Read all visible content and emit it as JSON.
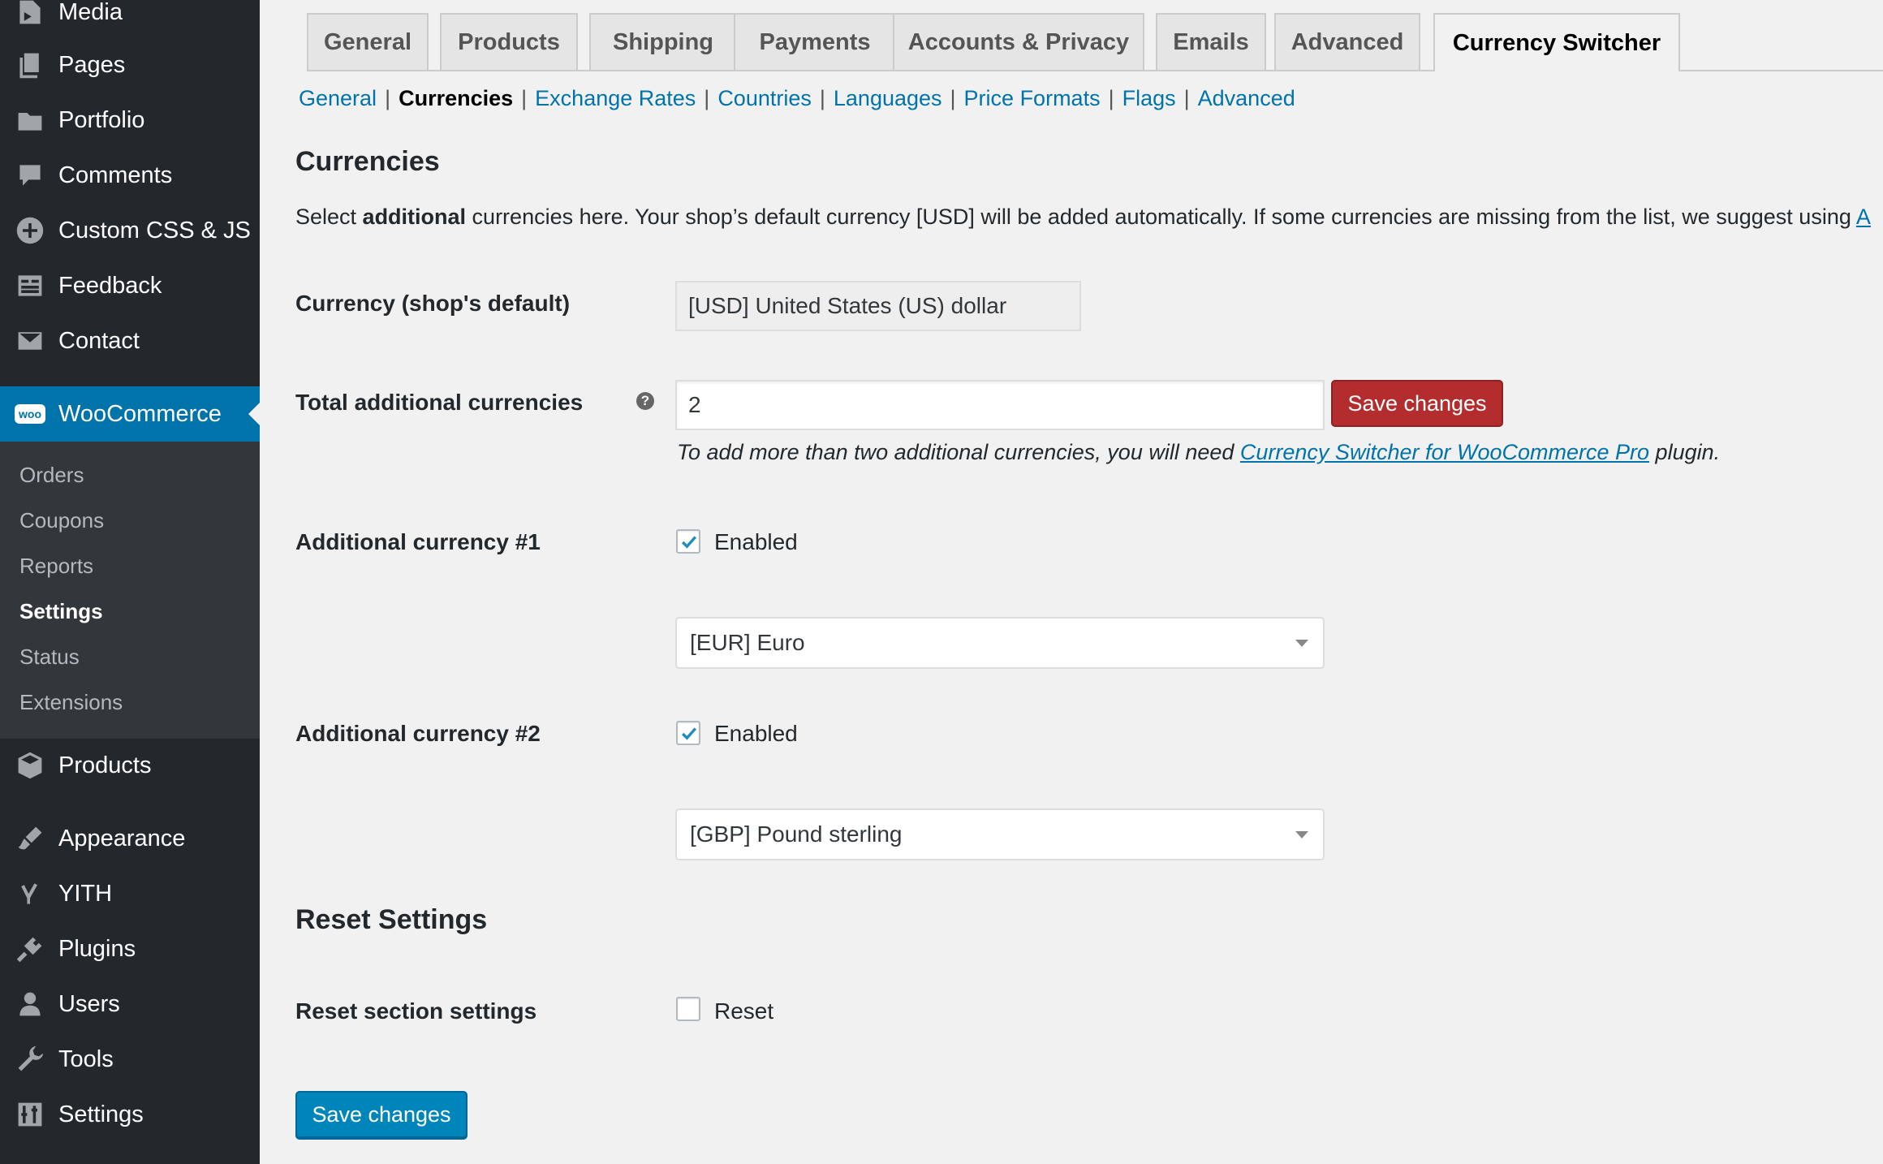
{
  "sidebar": {
    "items": [
      {
        "label": "Media",
        "icon": "media-icon"
      },
      {
        "label": "Pages",
        "icon": "pages-icon"
      },
      {
        "label": "Portfolio",
        "icon": "portfolio-icon"
      },
      {
        "label": "Comments",
        "icon": "comments-icon"
      },
      {
        "label": "Custom CSS & JS",
        "icon": "plus-circle-icon"
      },
      {
        "label": "Feedback",
        "icon": "feedback-icon"
      },
      {
        "label": "Contact",
        "icon": "mail-icon"
      }
    ],
    "woocommerce": {
      "label": "WooCommerce",
      "icon": "woocommerce-icon",
      "icon_text": "woo"
    },
    "woo_submenu": [
      "Orders",
      "Coupons",
      "Reports",
      "Settings",
      "Status",
      "Extensions"
    ],
    "woo_submenu_current": "Settings",
    "lower_items": [
      {
        "label": "Products",
        "icon": "products-box-icon"
      },
      {
        "label": "Appearance",
        "icon": "appearance-brush-icon"
      },
      {
        "label": "YITH",
        "icon": "yith-icon"
      },
      {
        "label": "Plugins",
        "icon": "plugins-icon"
      },
      {
        "label": "Users",
        "icon": "users-icon"
      },
      {
        "label": "Tools",
        "icon": "tools-wrench-icon"
      },
      {
        "label": "Settings",
        "icon": "settings-sliders-icon"
      }
    ]
  },
  "tabs": [
    "General",
    "Products",
    "Shipping",
    "Payments",
    "Accounts & Privacy",
    "Emails",
    "Advanced",
    "Currency Switcher"
  ],
  "active_tab": "Currency Switcher",
  "subnav": [
    "General",
    "Currencies",
    "Exchange Rates",
    "Countries",
    "Languages",
    "Price Formats",
    "Flags",
    "Advanced"
  ],
  "subnav_current": "Currencies",
  "section": {
    "title": "Currencies",
    "intro_prefix": "Select ",
    "intro_bold": "additional",
    "intro_rest": " currencies here. Your shop’s default currency [USD] will be added automatically. If some currencies are missing from the list, we suggest using ",
    "intro_link_fragment": "A"
  },
  "default_currency": {
    "label": "Currency (shop's default)",
    "value": "[USD] United States (US) dollar"
  },
  "total_additional": {
    "label": "Total additional currencies",
    "help": "?",
    "value": "2",
    "save_label": "Save changes",
    "desc_prefix": "To add more than two additional currencies, you will need ",
    "desc_link": "Currency Switcher for WooCommerce Pro",
    "desc_suffix": " plugin."
  },
  "additional": [
    {
      "label": "Additional currency #1",
      "enabled": true,
      "enabled_label": "Enabled",
      "value": "[EUR] Euro"
    },
    {
      "label": "Additional currency #2",
      "enabled": true,
      "enabled_label": "Enabled",
      "value": "[GBP] Pound sterling"
    }
  ],
  "reset": {
    "title": "Reset Settings",
    "row_label": "Reset section settings",
    "checkbox_label": "Reset",
    "checked": false
  },
  "footer": {
    "save_label": "Save changes"
  },
  "colors": {
    "sidebar": "#23282d",
    "accent": "#0073aa",
    "danger": "#b32d2e",
    "primary_button": "#0085ba"
  }
}
